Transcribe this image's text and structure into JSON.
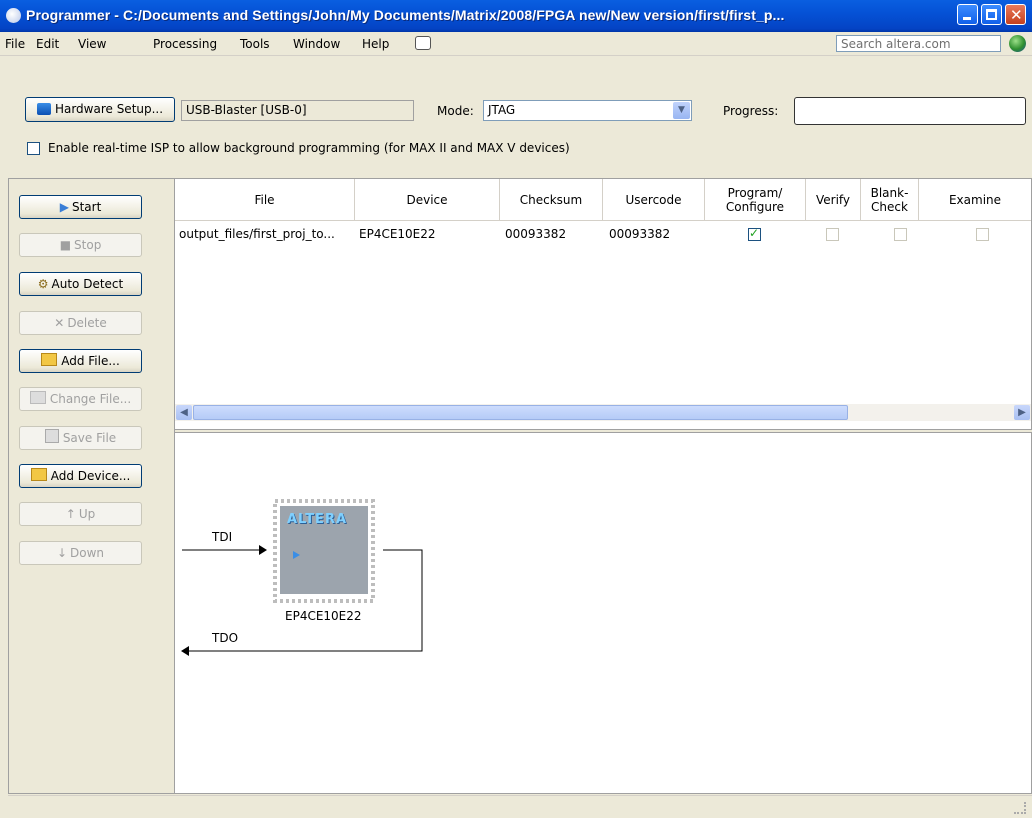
{
  "window": {
    "title": "Programmer - C:/Documents and Settings/John/My Documents/Matrix/2008/FPGA new/New version/first/first_p..."
  },
  "menu": {
    "items": [
      "File",
      "Edit",
      "View",
      "Processing",
      "Tools",
      "Window",
      "Help"
    ],
    "search_placeholder": "Search altera.com"
  },
  "toolbar": {
    "hardware_setup_label": "Hardware Setup...",
    "hardware_value": "USB-Blaster [USB-0]",
    "mode_label": "Mode:",
    "mode_value": "JTAG",
    "progress_label": "Progress:",
    "progress_value": "",
    "isp_checkbox_label": "Enable real-time ISP to allow background programming (for MAX II and MAX V devices)",
    "isp_checked": false
  },
  "left_buttons": [
    {
      "label": "Start",
      "enabled": true
    },
    {
      "label": "Stop",
      "enabled": false
    },
    {
      "label": "Auto Detect",
      "enabled": true
    },
    {
      "label": "Delete",
      "enabled": false
    },
    {
      "label": "Add File...",
      "enabled": true
    },
    {
      "label": "Change File...",
      "enabled": false
    },
    {
      "label": "Save File",
      "enabled": false
    },
    {
      "label": "Add Device...",
      "enabled": true
    },
    {
      "label": "Up",
      "enabled": false
    },
    {
      "label": "Down",
      "enabled": false
    }
  ],
  "table": {
    "columns": [
      "File",
      "Device",
      "Checksum",
      "Usercode",
      "Program/\nConfigure",
      "Verify",
      "Blank-\nCheck",
      "Examine"
    ],
    "rows": [
      {
        "file": "output_files/first_proj_to...",
        "device": "EP4CE10E22",
        "checksum": "00093382",
        "usercode": "00093382",
        "program": true,
        "verify": false,
        "blank_check": false,
        "examine": false
      }
    ]
  },
  "chain": {
    "tdi_label": "TDI",
    "tdo_label": "TDO",
    "device_label": "EP4CE10E22",
    "chip_logo": "ALTERA"
  }
}
